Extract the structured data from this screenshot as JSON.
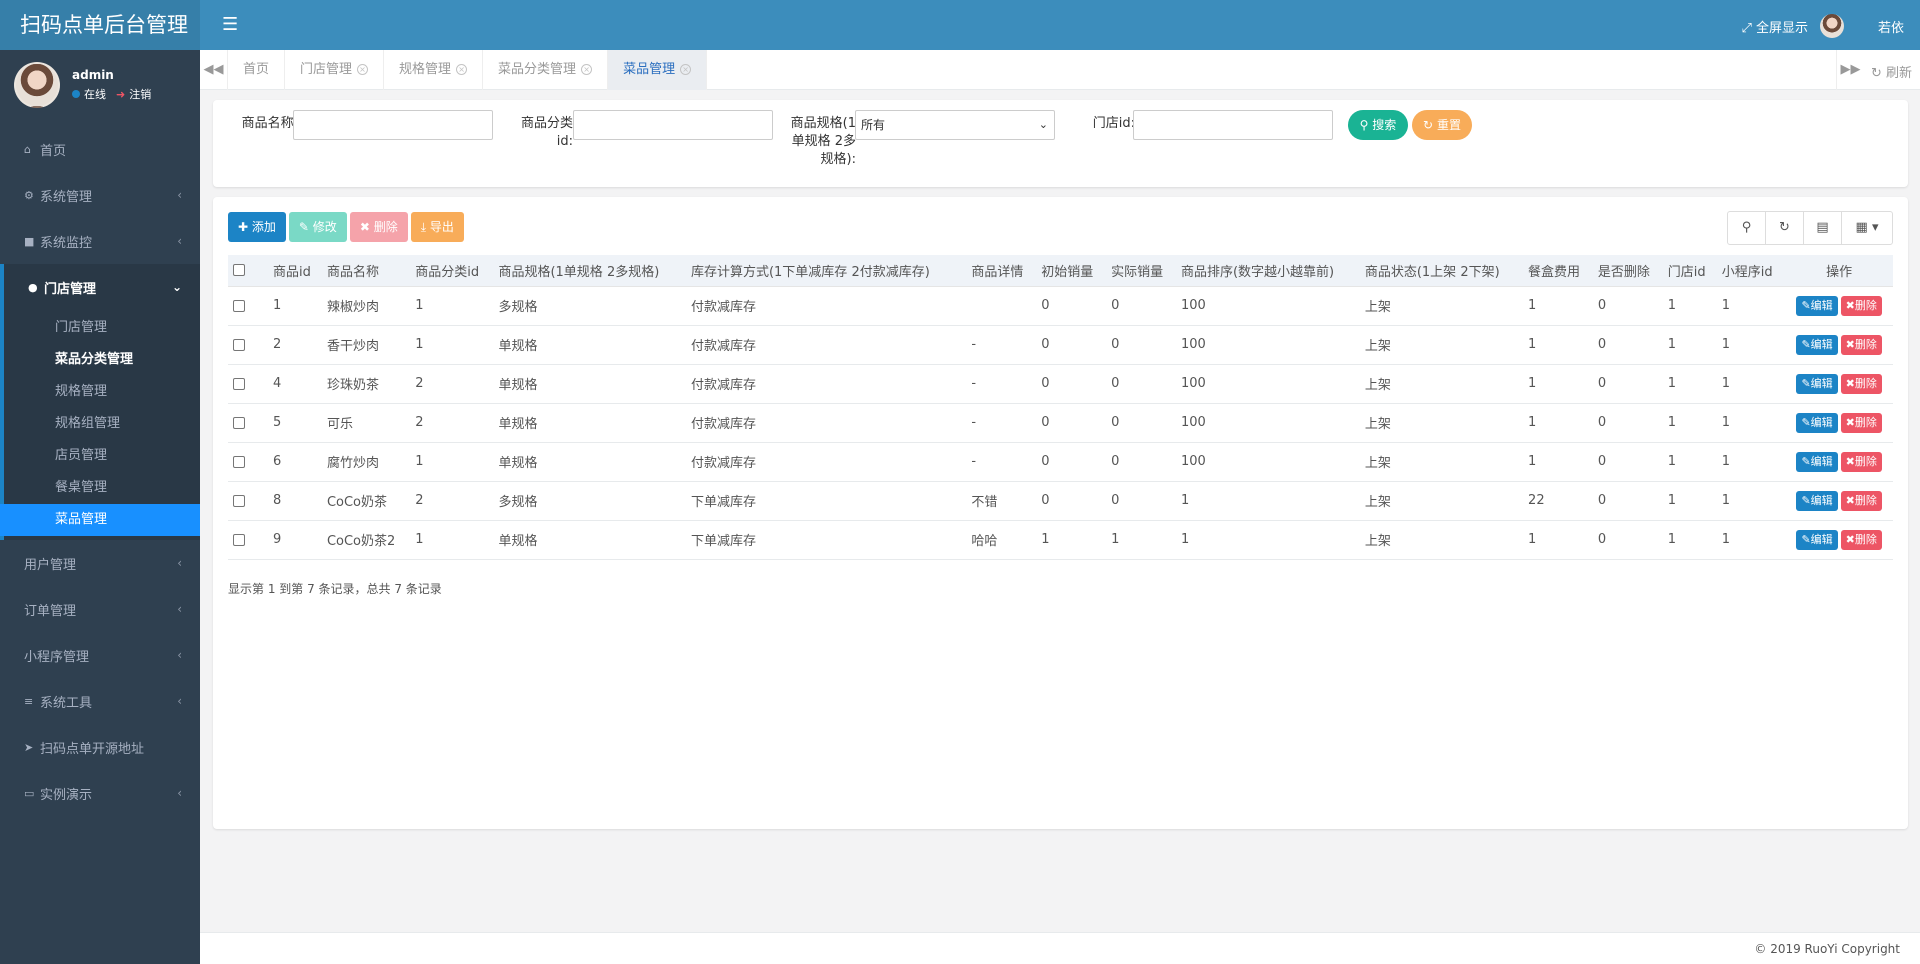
{
  "app": {
    "title": "扫码点单后台管理"
  },
  "user": {
    "name": "admin",
    "status": "在线",
    "logout": "注销"
  },
  "header": {
    "menu_icon": "hamburger-icon",
    "fullscreen": "全屏显示",
    "username": "若依"
  },
  "sidebar": {
    "items": [
      {
        "label": "首页",
        "icon": "home-icon"
      },
      {
        "label": "系统管理",
        "icon": "gear-icon"
      },
      {
        "label": "系统监控",
        "icon": "video-icon"
      },
      {
        "label": "门店管理",
        "icon": "circle-icon"
      },
      {
        "label": "用户管理",
        "icon": ""
      },
      {
        "label": "订单管理",
        "icon": ""
      },
      {
        "label": "小程序管理",
        "icon": ""
      },
      {
        "label": "系统工具",
        "icon": "bars-icon"
      },
      {
        "label": "扫码点单开源地址",
        "icon": "location-arrow-icon"
      },
      {
        "label": "实例演示",
        "icon": "desktop-icon"
      }
    ],
    "submenu": [
      "门店管理",
      "菜品分类管理",
      "规格管理",
      "规格组管理",
      "店员管理",
      "餐桌管理",
      "菜品管理"
    ]
  },
  "tabs": {
    "items": [
      "首页",
      "门店管理",
      "规格管理",
      "菜品分类管理",
      "菜品管理"
    ],
    "refresh": "刷新"
  },
  "search": {
    "name_label": "商品名称:",
    "category_label_1": "商品分类",
    "category_label_2": "id:",
    "spec_label_1": "商品规格(1",
    "spec_label_2": "单规格 2多",
    "spec_label_3": "规格):",
    "spec_value": "所有",
    "store_label": "门店id:",
    "search_btn": "搜索",
    "reset_btn": "重置"
  },
  "toolbar": {
    "add": "添加",
    "edit": "修改",
    "delete": "删除",
    "export": "导出"
  },
  "table": {
    "columns": [
      "商品id",
      "商品名称",
      "商品分类id",
      "商品规格(1单规格 2多规格)",
      "库存计算方式(1下单减库存 2付款减库存)",
      "商品详情",
      "初始销量",
      "实际销量",
      "商品排序(数字越小越靠前)",
      "商品状态(1上架 2下架)",
      "餐盒费用",
      "是否删除",
      "门店id",
      "小程序id",
      "操作"
    ],
    "rows": [
      [
        "1",
        "辣椒炒肉",
        "1",
        "多规格",
        "付款减库存",
        "",
        "0",
        "0",
        "100",
        "上架",
        "1",
        "0",
        "1",
        "1"
      ],
      [
        "2",
        "香干炒肉",
        "1",
        "单规格",
        "付款减库存",
        "-",
        "0",
        "0",
        "100",
        "上架",
        "1",
        "0",
        "1",
        "1"
      ],
      [
        "4",
        "珍珠奶茶",
        "2",
        "单规格",
        "付款减库存",
        "-",
        "0",
        "0",
        "100",
        "上架",
        "1",
        "0",
        "1",
        "1"
      ],
      [
        "5",
        "可乐",
        "2",
        "单规格",
        "付款减库存",
        "-",
        "0",
        "0",
        "100",
        "上架",
        "1",
        "0",
        "1",
        "1"
      ],
      [
        "6",
        "腐竹炒肉",
        "1",
        "单规格",
        "付款减库存",
        "-",
        "0",
        "0",
        "100",
        "上架",
        "1",
        "0",
        "1",
        "1"
      ],
      [
        "8",
        "CoCo奶茶",
        "2",
        "多规格",
        "下单减库存",
        "不错",
        "0",
        "0",
        "1",
        "上架",
        "22",
        "0",
        "1",
        "1"
      ],
      [
        "9",
        "CoCo奶茶2",
        "1",
        "单规格",
        "下单减库存",
        "哈哈",
        "1",
        "1",
        "1",
        "上架",
        "1",
        "0",
        "1",
        "1"
      ]
    ],
    "edit_label": "编辑",
    "delete_label": "删除",
    "pageinfo": "显示第 1 到第 7 条记录，总共 7 条记录"
  },
  "footer": {
    "copyright": "© 2019 RuoYi Copyright"
  }
}
